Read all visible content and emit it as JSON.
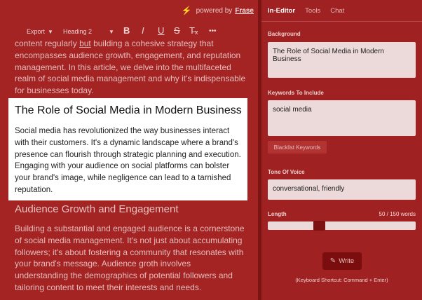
{
  "editor": {
    "powered_by_label": "powered by",
    "brand": "Frase",
    "toolbar": {
      "export_label": "Export",
      "heading_label": "Heading 2",
      "bold_icon": "B",
      "italic_icon": "I",
      "underline_icon": "U",
      "strike_icon": "S",
      "clear_format_icon": "T̶ₓ",
      "more_icon": "•••"
    },
    "intro_before": "content regularly ",
    "intro_underlined": "but",
    "intro_after": " building a cohesive strategy that encompasses audience growth, engagement, and reputation management. In this article, we delve into the multifaceted realm of social media management and why it's indispensable for businesses today.",
    "highlight_title": "The Role of Social Media in Modern Business",
    "highlight_body": "Social media has revolutionized the way businesses interact with their customers. It's a dynamic landscape where a brand's presence can flourish through strategic planning and execution. Engaging with your audience on social platforms can bolster your brand's image, while negligence can lead to a tarnished reputation.",
    "section2_title": "Audience Growth and Engagement",
    "section2_body": "Building a substantial and engaged audience is a cornerstone of social media management. It's not just about accumulating followers; it's about fostering a community that resonates with your brand's message. Audience groth involves understanding the demographics of potential followers and tailoring content to meet their interests and needs."
  },
  "panel": {
    "tabs": [
      {
        "label": "In-Editor",
        "active": true
      },
      {
        "label": "Tools",
        "active": false
      },
      {
        "label": "Chat",
        "active": false
      }
    ],
    "background_label": "Background",
    "background_value": "The Role of Social Media in Modern Business",
    "keywords_label": "Keywords To Include",
    "keywords_value": "social media",
    "blacklist_label": "Blacklist Keywords",
    "tone_label": "Tone Of Voice",
    "tone_value": "conversational, friendly",
    "length_label": "Length",
    "length_count": "50 / 150 words",
    "length_fraction": 0.333,
    "write_label": "Write",
    "shortcut_text": "(Keyboard Shortcut: Command + Enter)"
  }
}
